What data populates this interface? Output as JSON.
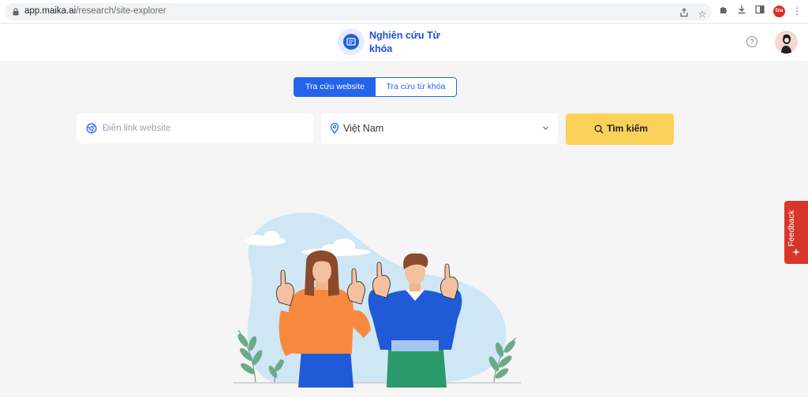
{
  "browser": {
    "url_host": "app.maika.ai",
    "url_path": "/research/site-explorer",
    "profile_badge": "Gia"
  },
  "header": {
    "title": "Nghiên cứu Từ khóa",
    "help_icon": "?",
    "brand_color": "#1d4ed8"
  },
  "tabs": [
    {
      "label": "Tra cứu website",
      "active": true
    },
    {
      "label": "Tra cứu từ khóa",
      "active": false
    }
  ],
  "search": {
    "url_placeholder": "Điền link website",
    "url_value": "",
    "country_value": "Việt Nam",
    "button_label": "Tìm kiếm",
    "button_color": "#fcd15a"
  },
  "feedback": {
    "label": "Feedback",
    "color": "#d9362b"
  },
  "icons": {
    "omnibox": [
      "lock-icon",
      "share-icon",
      "star-icon"
    ],
    "toolbar": [
      "extensions-icon",
      "download-icon",
      "side-panel-icon",
      "menu-icon"
    ],
    "search_row": [
      "globe-icon",
      "map-pin-icon",
      "chevron-down-icon",
      "search-icon"
    ]
  }
}
